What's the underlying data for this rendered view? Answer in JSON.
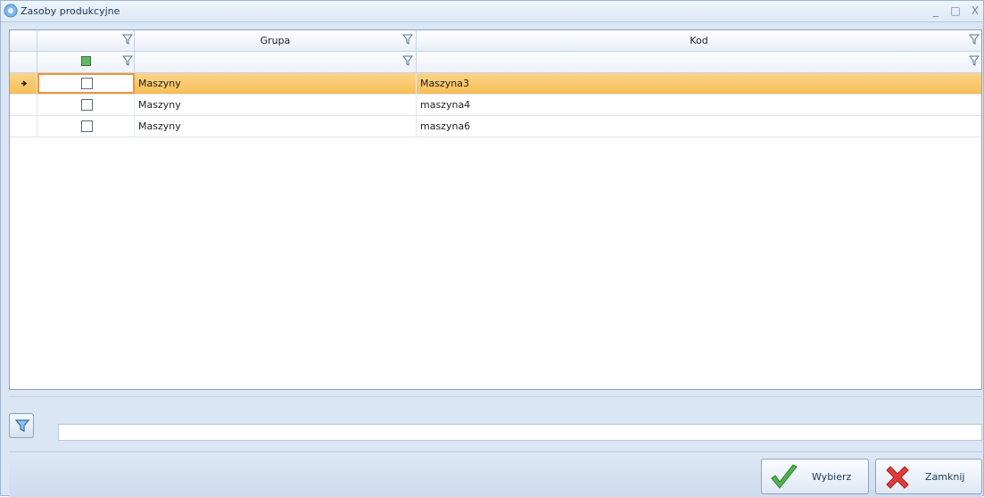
{
  "window": {
    "title": "Zasoby produkcyjne",
    "controls": {
      "minimize": "_",
      "maximize": "□",
      "close": "X"
    }
  },
  "grid": {
    "columns": [
      {
        "label": ""
      },
      {
        "label": "Grupa"
      },
      {
        "label": "Kod"
      }
    ],
    "rows": [
      {
        "checked": false,
        "grupa": "Maszyny",
        "kod": "Maszyna3",
        "selected": true
      },
      {
        "checked": false,
        "grupa": "Maszyny",
        "kod": "maszyna4",
        "selected": false
      },
      {
        "checked": false,
        "grupa": "Maszyny",
        "kod": "maszyna6",
        "selected": false
      }
    ]
  },
  "filter": {
    "value": ""
  },
  "buttons": {
    "select_label": "Wybierz",
    "close_label": "Zamknij"
  },
  "colors": {
    "selected_row": "#f8bf55",
    "focus_outline": "#f29436",
    "accent": "#1e395b"
  }
}
